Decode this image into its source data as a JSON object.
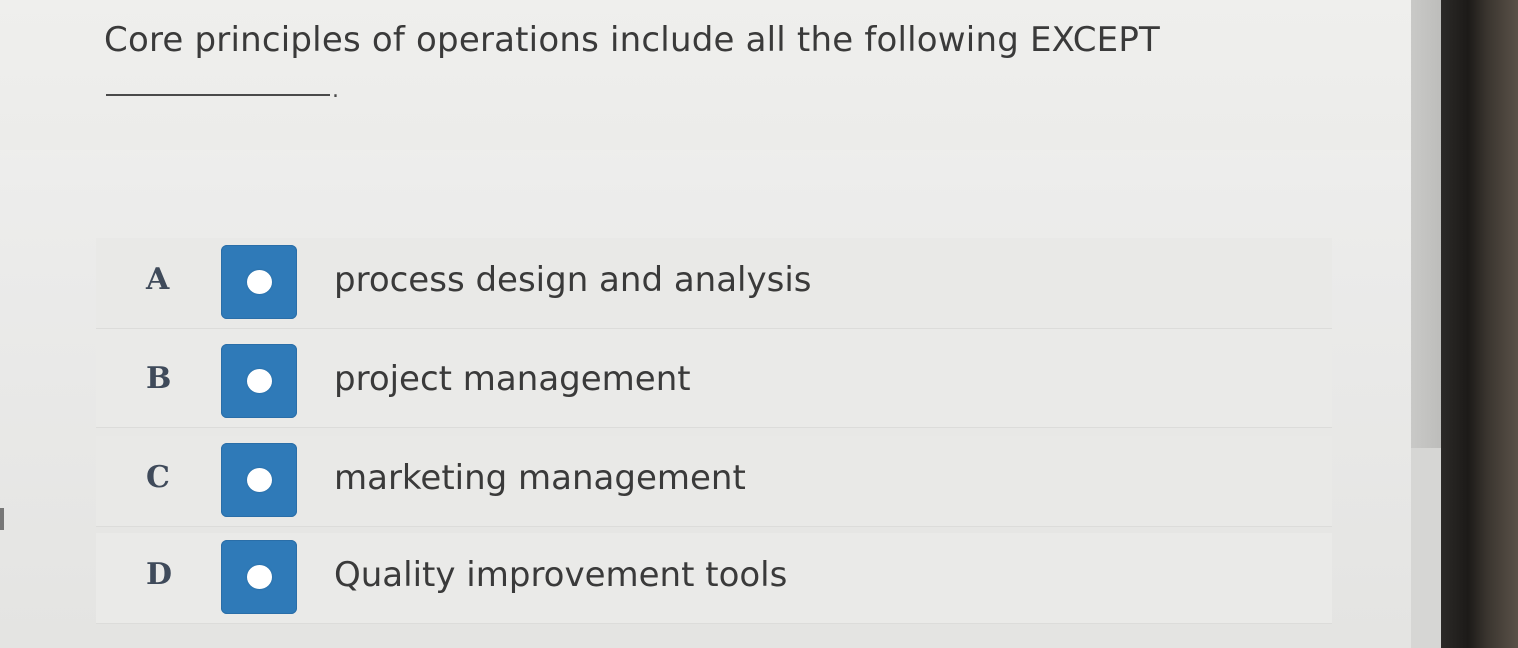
{
  "question": {
    "text": "Core principles of operations include all the following EXCEPT",
    "blank_suffix": "."
  },
  "options": [
    {
      "letter": "A",
      "text": "process design and analysis"
    },
    {
      "letter": "B",
      "text": "project management"
    },
    {
      "letter": "C",
      "text": "marketing management"
    },
    {
      "letter": "D",
      "text": "Quality improvement tools"
    }
  ],
  "colors": {
    "option_box": "#2f7ab8",
    "background": "#ebebea",
    "text": "#3a3a3a"
  }
}
